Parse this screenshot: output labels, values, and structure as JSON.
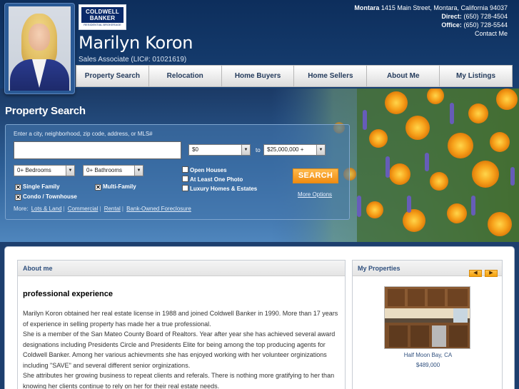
{
  "agent": {
    "name": "Marilyn Koron",
    "title": "Sales Associate (LIC#: 01021619)"
  },
  "logo": {
    "line1": "COLDWELL",
    "line2": "BANKER",
    "line3": "RESIDENTIAL BROKERAGE"
  },
  "contact": {
    "office_name": "Montara",
    "address": "1415 Main Street, Montara, California 94037",
    "direct_label": "Direct:",
    "direct": "(650) 728-4504",
    "office_label": "Office:",
    "office": "(650) 728-5544",
    "contact_link": "Contact Me"
  },
  "nav": {
    "items": [
      "Property Search",
      "Relocation",
      "Home Buyers",
      "Home Sellers",
      "About Me",
      "My Listings"
    ]
  },
  "search": {
    "title": "Property Search",
    "hint": "Enter a city, neighborhood, zip code, address, or MLS#",
    "input_value": "",
    "min_price": "$0",
    "to_label": "to",
    "max_price": "$25,000,000 +",
    "bedrooms": "0+ Bedrooms",
    "bathrooms": "0+ Bathrooms",
    "property_types": [
      {
        "label": "Single Family",
        "checked": true
      },
      {
        "label": "Multi-Family",
        "checked": true
      },
      {
        "label": "Condo / Townhouse",
        "checked": true
      }
    ],
    "options": [
      {
        "label": "Open Houses",
        "checked": false
      },
      {
        "label": "At Least One Photo",
        "checked": false
      },
      {
        "label": "Luxury Homes & Estates",
        "checked": false
      }
    ],
    "button": "SEARCH",
    "more_options": "More Options",
    "more_label": "More:",
    "more_links": [
      "Lots & Land",
      "Commercial",
      "Rental",
      "Bank-Owned Foreclosure"
    ]
  },
  "about": {
    "header": "About me",
    "heading": "professional experience",
    "paragraphs": [
      "Marilyn Koron obtained her real estate license in 1988 and joined Coldwell Banker in 1990. More than 17 years of experience in selling property has made her a true professional.",
      "She is a member of the San Mateo County Board of Realtors. Year after year she has achieved several award designations including Presidents Circle and Presidents Elite for being among the top producing agents for Coldwell Banker. Among her various achievments she has enjoyed working with her volunteer orginizations including \"SAVE\" and several different senior  orginizations.",
      "She attributes her growing business to repeat clients and referals.  There is nothing more gratifying to her than knowing her clients continue to rely on her for their real estate needs."
    ]
  },
  "properties": {
    "header": "My Properties",
    "prev_icon": "arrow-left-icon",
    "next_icon": "arrow-right-icon",
    "location": "Half Moon Bay, CA",
    "price": "$489,000"
  },
  "colors": {
    "header_bg": "#0d2e5c",
    "accent_orange": "#f08c12",
    "link_blue": "#30507e"
  }
}
